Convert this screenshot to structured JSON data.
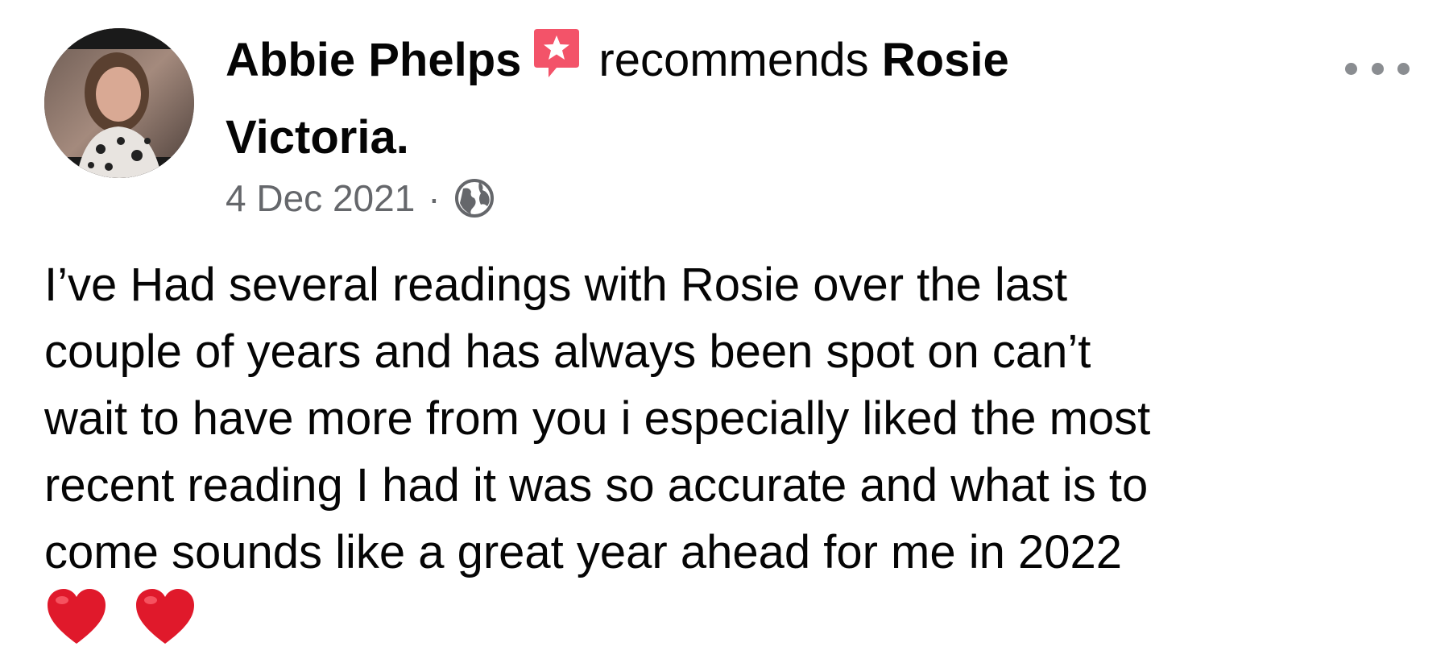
{
  "post": {
    "author_name": "Abbie Phelps",
    "action_text": "recommends",
    "target_name_part1": "Rosie",
    "target_name_part2": "Victoria.",
    "date": "4 Dec 2021",
    "separator": "·",
    "privacy_icon": "globe-icon",
    "recommend_icon": "recommend-star-icon",
    "more_icon": "more-options-icon",
    "body_lines": [
      "I’ve Had several readings with Rosie over the last",
      "couple of years and has always been spot on can’t",
      "wait to have more from you i especially liked the most",
      "recent reading I had it was so accurate and what is to",
      "come sounds like a great year ahead for me in 2022"
    ],
    "emojis": [
      "❤️",
      "❤️"
    ]
  },
  "colors": {
    "text_primary": "#050505",
    "text_secondary": "#65676b",
    "recommend_badge": "#f35369",
    "heart": "#e0192b"
  }
}
